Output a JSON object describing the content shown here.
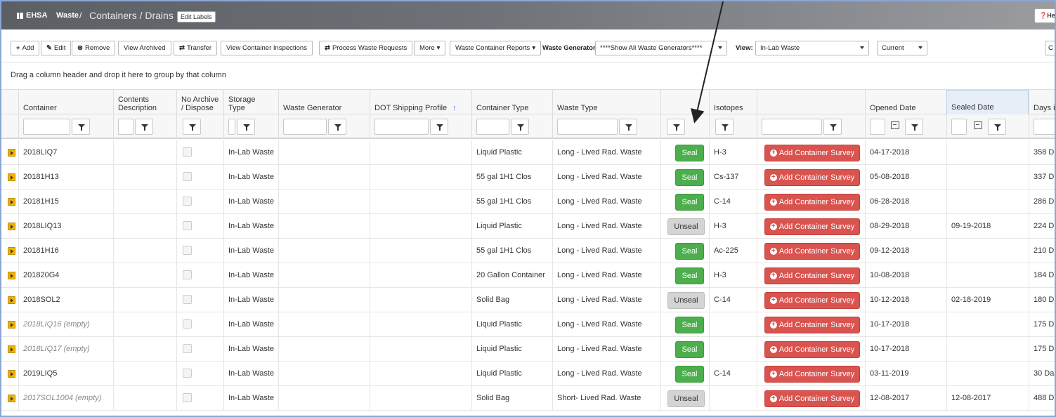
{
  "header": {
    "brand": "EHSA",
    "crumb_module": "Waste",
    "crumb_sep": "/",
    "crumb_page": "Containers / Drains",
    "edit_labels": "Edit Labels",
    "help": "He"
  },
  "toolbar": {
    "add": "Add",
    "edit": "Edit",
    "remove": "Remove",
    "view_archived": "View Archived",
    "transfer": "Transfer",
    "view_inspections": "View Container Inspections",
    "process_requests": "Process Waste Requests",
    "more": "More",
    "reports": "Waste Container Reports",
    "generator_label": "Waste Generator:",
    "generator_value": "****Show All Waste Generators****",
    "view_label": "View:",
    "view_value": "In-Lab Waste",
    "status_value": "Current"
  },
  "group_hint": "Drag a column header and drop it here to group by that column",
  "columns": {
    "container": "Container",
    "contents_1": "Contents",
    "contents_2": "Description",
    "archive_1": "No Archive",
    "archive_2": "/ Dispose",
    "storage": "Storage Type",
    "generator": "Waste Generator",
    "dot": "DOT Shipping Profile",
    "dot_sort": "↑",
    "ctype": "Container Type",
    "wtype": "Waste Type",
    "seal": "",
    "isotopes": "Isotopes",
    "survey": "",
    "opened": "Opened Date",
    "sealed": "Sealed Date",
    "days": "Days i"
  },
  "buttons": {
    "seal": "Seal",
    "unseal": "Unseal",
    "add_survey": "Add Container Survey"
  },
  "rows": [
    {
      "container": "2018LIQ7",
      "empty": false,
      "storage": "In-Lab Waste",
      "ctype": "Liquid Plastic",
      "wtype": "Long - Lived Rad. Waste",
      "sealed": false,
      "isotope": "H-3",
      "opened": "04-17-2018",
      "sealed_date": "",
      "days": "358 D"
    },
    {
      "container": "20181H13",
      "empty": false,
      "storage": "In-Lab Waste",
      "ctype": "55 gal 1H1 Clos",
      "wtype": "Long - Lived Rad. Waste",
      "sealed": false,
      "isotope": "Cs-137",
      "opened": "05-08-2018",
      "sealed_date": "",
      "days": "337 D"
    },
    {
      "container": "20181H15",
      "empty": false,
      "storage": "In-Lab Waste",
      "ctype": "55 gal 1H1 Clos",
      "wtype": "Long - Lived Rad. Waste",
      "sealed": false,
      "isotope": "C-14",
      "opened": "06-28-2018",
      "sealed_date": "",
      "days": "286 D"
    },
    {
      "container": "2018LIQ13",
      "empty": false,
      "storage": "In-Lab Waste",
      "ctype": "Liquid Plastic",
      "wtype": "Long - Lived Rad. Waste",
      "sealed": true,
      "isotope": "H-3",
      "opened": "08-29-2018",
      "sealed_date": "09-19-2018",
      "days": "224 D"
    },
    {
      "container": "20181H16",
      "empty": false,
      "storage": "In-Lab Waste",
      "ctype": "55 gal 1H1 Clos",
      "wtype": "Long - Lived Rad. Waste",
      "sealed": false,
      "isotope": "Ac-225",
      "opened": "09-12-2018",
      "sealed_date": "",
      "days": "210 D"
    },
    {
      "container": "201820G4",
      "empty": false,
      "storage": "In-Lab Waste",
      "ctype": "20 Gallon Container",
      "wtype": "Long - Lived Rad. Waste",
      "sealed": false,
      "isotope": "H-3",
      "opened": "10-08-2018",
      "sealed_date": "",
      "days": "184 D"
    },
    {
      "container": "2018SOL2",
      "empty": false,
      "storage": "In-Lab Waste",
      "ctype": "Solid Bag",
      "wtype": "Long - Lived Rad. Waste",
      "sealed": true,
      "isotope": "C-14",
      "opened": "10-12-2018",
      "sealed_date": "02-18-2019",
      "days": "180 D"
    },
    {
      "container": "2018LIQ16 (empty)",
      "empty": true,
      "storage": "In-Lab Waste",
      "ctype": "Liquid Plastic",
      "wtype": "Long - Lived Rad. Waste",
      "sealed": false,
      "isotope": "",
      "opened": "10-17-2018",
      "sealed_date": "",
      "days": "175 D"
    },
    {
      "container": "2018LIQ17 (empty)",
      "empty": true,
      "storage": "In-Lab Waste",
      "ctype": "Liquid Plastic",
      "wtype": "Long - Lived Rad. Waste",
      "sealed": false,
      "isotope": "",
      "opened": "10-17-2018",
      "sealed_date": "",
      "days": "175 D"
    },
    {
      "container": "2019LIQ5",
      "empty": false,
      "storage": "In-Lab Waste",
      "ctype": "Liquid Plastic",
      "wtype": "Long - Lived Rad. Waste",
      "sealed": false,
      "isotope": "C-14",
      "opened": "03-11-2019",
      "sealed_date": "",
      "days": "30 Da"
    },
    {
      "container": "2017SOL1004 (empty)",
      "empty": true,
      "storage": "In-Lab Waste",
      "ctype": "Solid Bag",
      "wtype": "Short- Lived Rad. Waste",
      "sealed": true,
      "isotope": "",
      "opened": "12-08-2017",
      "sealed_date": "12-08-2017",
      "days": "488 D"
    }
  ]
}
